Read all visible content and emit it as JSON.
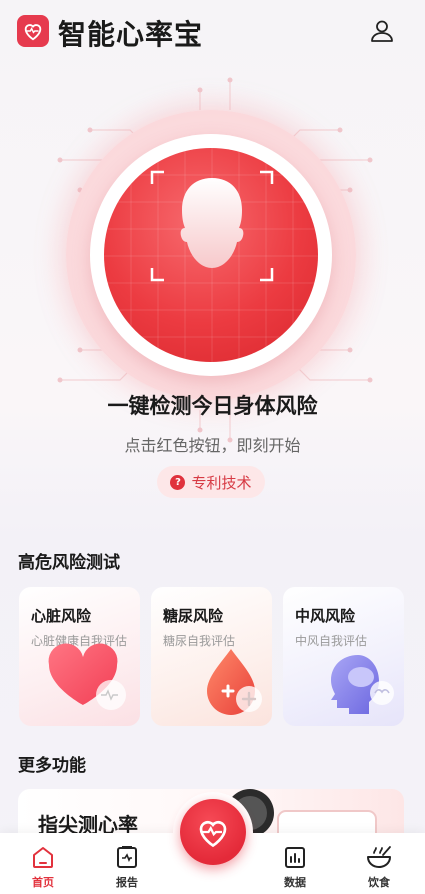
{
  "app": {
    "title": "智能心率宝"
  },
  "hero": {
    "title": "一键检测今日身体风险",
    "subtitle": "点击红色按钮，即刻开始",
    "patent_label": "专利技术",
    "patent_badge_icon": "?"
  },
  "risk_section": {
    "title": "高危风险测试",
    "cards": [
      {
        "title": "心脏风险",
        "subtitle": "心脏健康自我评估",
        "icon": "heart-icon",
        "bg": "#fbe6e9"
      },
      {
        "title": "糖尿风险",
        "subtitle": "糖尿自我评估",
        "icon": "blood-drop-icon",
        "bg": "#fbe9e5"
      },
      {
        "title": "中风风险",
        "subtitle": "中风自我评估",
        "icon": "brain-head-icon",
        "bg": "#ecebfb"
      }
    ]
  },
  "more_section": {
    "title": "更多功能",
    "feature_card": {
      "title": "指尖测心率"
    }
  },
  "bottom_nav": {
    "items": [
      {
        "label": "首页",
        "icon": "home-icon",
        "active": true
      },
      {
        "label": "报告",
        "icon": "report-icon",
        "active": false
      },
      {
        "label": "数据",
        "icon": "data-chart-icon",
        "active": false
      },
      {
        "label": "饮食",
        "icon": "diet-bowl-icon",
        "active": false
      }
    ],
    "center_button_icon": "heart-pulse-icon"
  },
  "colors": {
    "accent": "#e63a4e",
    "accent_text": "#e2323d",
    "patent_bg": "#fde7e8"
  }
}
